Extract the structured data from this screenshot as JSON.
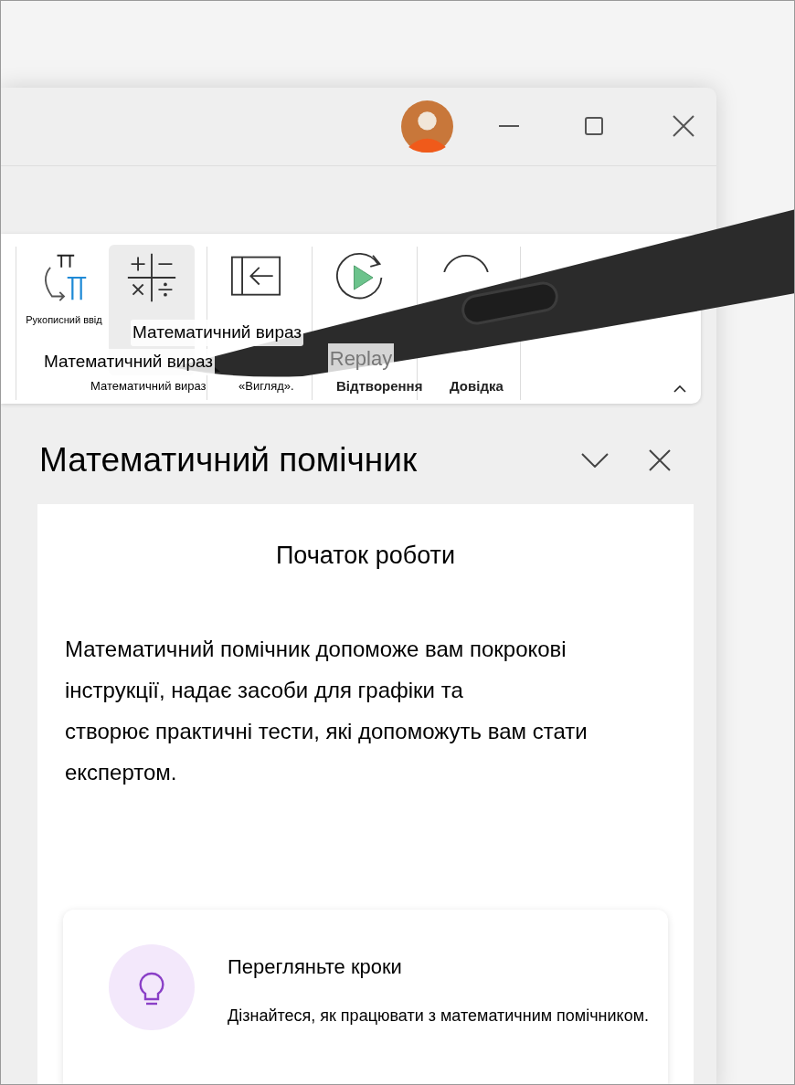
{
  "ribbon": {
    "buttons": [
      {
        "kind": "ink",
        "label": "Рукописний ввід",
        "selected": false
      },
      {
        "kind": "math",
        "selected": true
      },
      {
        "kind": "view",
        "selected": false
      },
      {
        "kind": "replay",
        "label": "Replay",
        "selected": false
      },
      {
        "kind": "help",
        "selected": false
      }
    ],
    "overlay_labels": [
      "Математичний вираз",
      "Математичний вираз"
    ],
    "groups": [
      {
        "label": "Математичний вираз",
        "emphasis": false
      },
      {
        "label": "«Вигляд».",
        "emphasis": false
      },
      {
        "label": "Відтворення",
        "emphasis": true
      },
      {
        "label": "Довідка",
        "emphasis": true
      }
    ]
  },
  "pane": {
    "title": "Математичний помічник",
    "card": {
      "heading": "Початок роботи",
      "text_lines": [
        "Математичний помічник допоможе вам покрокові",
        "інструкції, надає засоби для графіки та",
        "створює практичні тести, які допоможуть вам стати",
        "експертом."
      ],
      "feature": {
        "title": "Перегляньте кроки",
        "description": "Дізнайтеся, як працювати з математичним помічником."
      }
    }
  }
}
